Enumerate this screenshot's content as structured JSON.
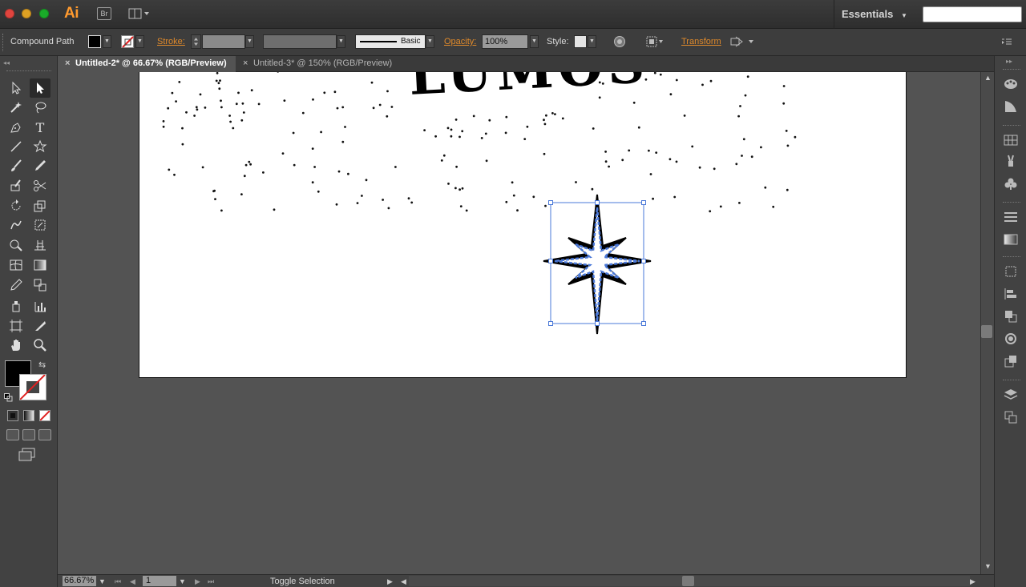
{
  "app": {
    "logo": "Ai",
    "bridge_label": "Br",
    "workspace": "Essentials",
    "search_placeholder": ""
  },
  "control_bar": {
    "selection_type": "Compound Path",
    "stroke_label": "Stroke:",
    "brush_profile": "Basic",
    "opacity_label": "Opacity:",
    "opacity_value": "100%",
    "style_label": "Style:",
    "transform_label": "Transform"
  },
  "tabs": [
    {
      "label": "Untitled-2* @ 66.67% (RGB/Preview)",
      "active": true
    },
    {
      "label": "Untitled-3* @ 150% (RGB/Preview)",
      "active": false
    }
  ],
  "artwork": {
    "title_text": "LUMOS",
    "selected_object": "eight-point star"
  },
  "status_bar": {
    "zoom": "66.67%",
    "page": "1",
    "status_text": "Toggle Selection"
  },
  "colors": {
    "accent_orange": "#e08a2b",
    "selection_blue": "#4a78d8",
    "fill": "#000000",
    "stroke": "none"
  }
}
